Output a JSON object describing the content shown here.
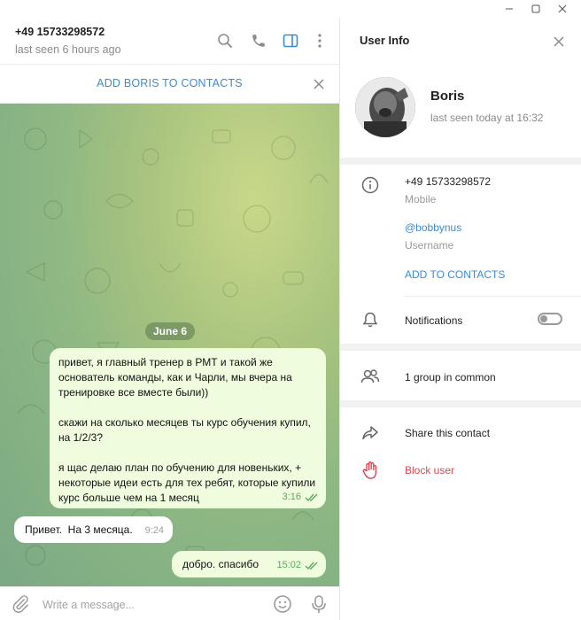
{
  "chat": {
    "contact_phone": "+49 15733298572",
    "last_seen": "last seen 6 hours ago",
    "add_contact_banner": "ADD BORIS TO CONTACTS",
    "date_separator": "June 6",
    "messages": [
      {
        "direction": "outgoing",
        "text": "привет, я главный тренер в РМТ и такой же основатель команды, как и Чарли, мы вчера на тренировке все вместе были))\n\nскажи на сколько месяцев ты курс обучения купил, на 1/2/3?\n\nя щас делаю план по обучению для новеньких, + некоторые идеи есть для тех ребят, которые купили курс больше чем на 1 месяц",
        "time": "3:16",
        "read": true
      },
      {
        "direction": "incoming",
        "text": "Привет.  На 3 месяца.",
        "time": "9:24"
      },
      {
        "direction": "outgoing",
        "text": "добро. спасибо",
        "time": "15:02",
        "read": true
      }
    ],
    "composer_placeholder": "Write a message..."
  },
  "user_info": {
    "title": "User Info",
    "name": "Boris",
    "status": "last seen today at 16:32",
    "phone": "+49 15733298572",
    "phone_label": "Mobile",
    "username": "@bobbynus",
    "username_label": "Username",
    "add_to_contacts": "ADD TO CONTACTS",
    "notifications_label": "Notifications",
    "notifications_enabled": false,
    "groups_in_common": "1 group in common",
    "share_contact": "Share this contact",
    "block_user": "Block user"
  },
  "colors": {
    "accent": "#3a8bd6",
    "outgoing_bubble": "#effdde",
    "read_check": "#5ca85b",
    "danger": "#e0474f"
  },
  "icons": {
    "header": [
      "search-icon",
      "phone-icon",
      "sidebar-panel-icon",
      "more-vertical-icon"
    ],
    "composer": [
      "paperclip-icon",
      "emoji-icon",
      "microphone-icon"
    ],
    "info_rows": [
      "info-icon",
      "bell-icon",
      "group-icon",
      "share-icon",
      "hand-stop-icon"
    ]
  }
}
